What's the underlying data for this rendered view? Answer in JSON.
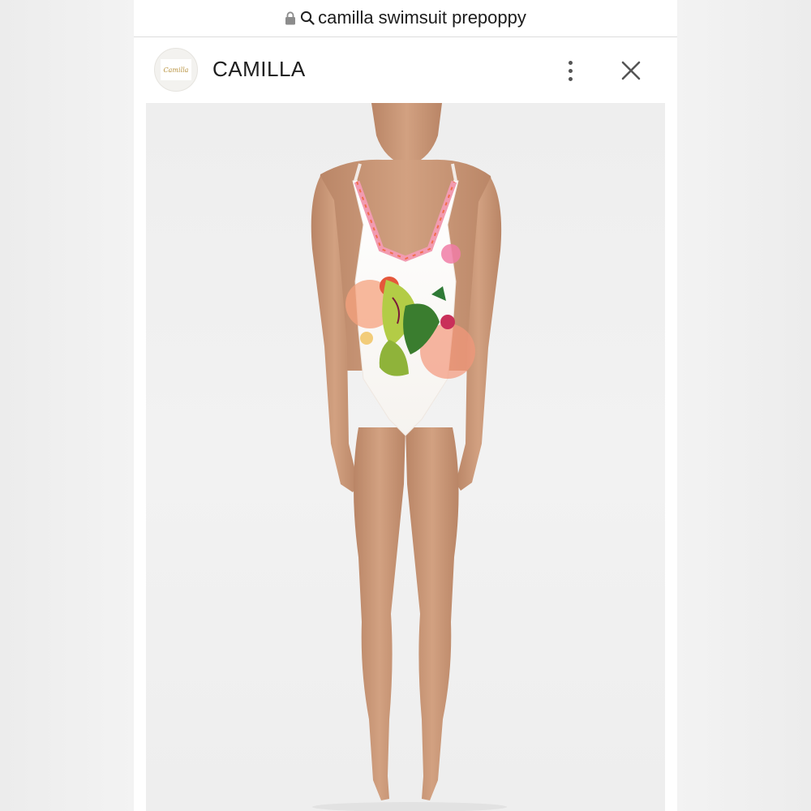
{
  "browser": {
    "url_text": "camilla swimsuit prepoppy"
  },
  "header": {
    "logo_script": "Camilla",
    "brand_name": "CAMILLA"
  },
  "colors": {
    "page_bg": "#f4f4f4",
    "header_bg": "#ffffff",
    "text": "#1e1e1e",
    "icon_gray": "#555555"
  },
  "icons": {
    "lock": "lock-icon",
    "search": "search-icon",
    "menu": "more-vertical-icon",
    "close": "close-icon"
  }
}
